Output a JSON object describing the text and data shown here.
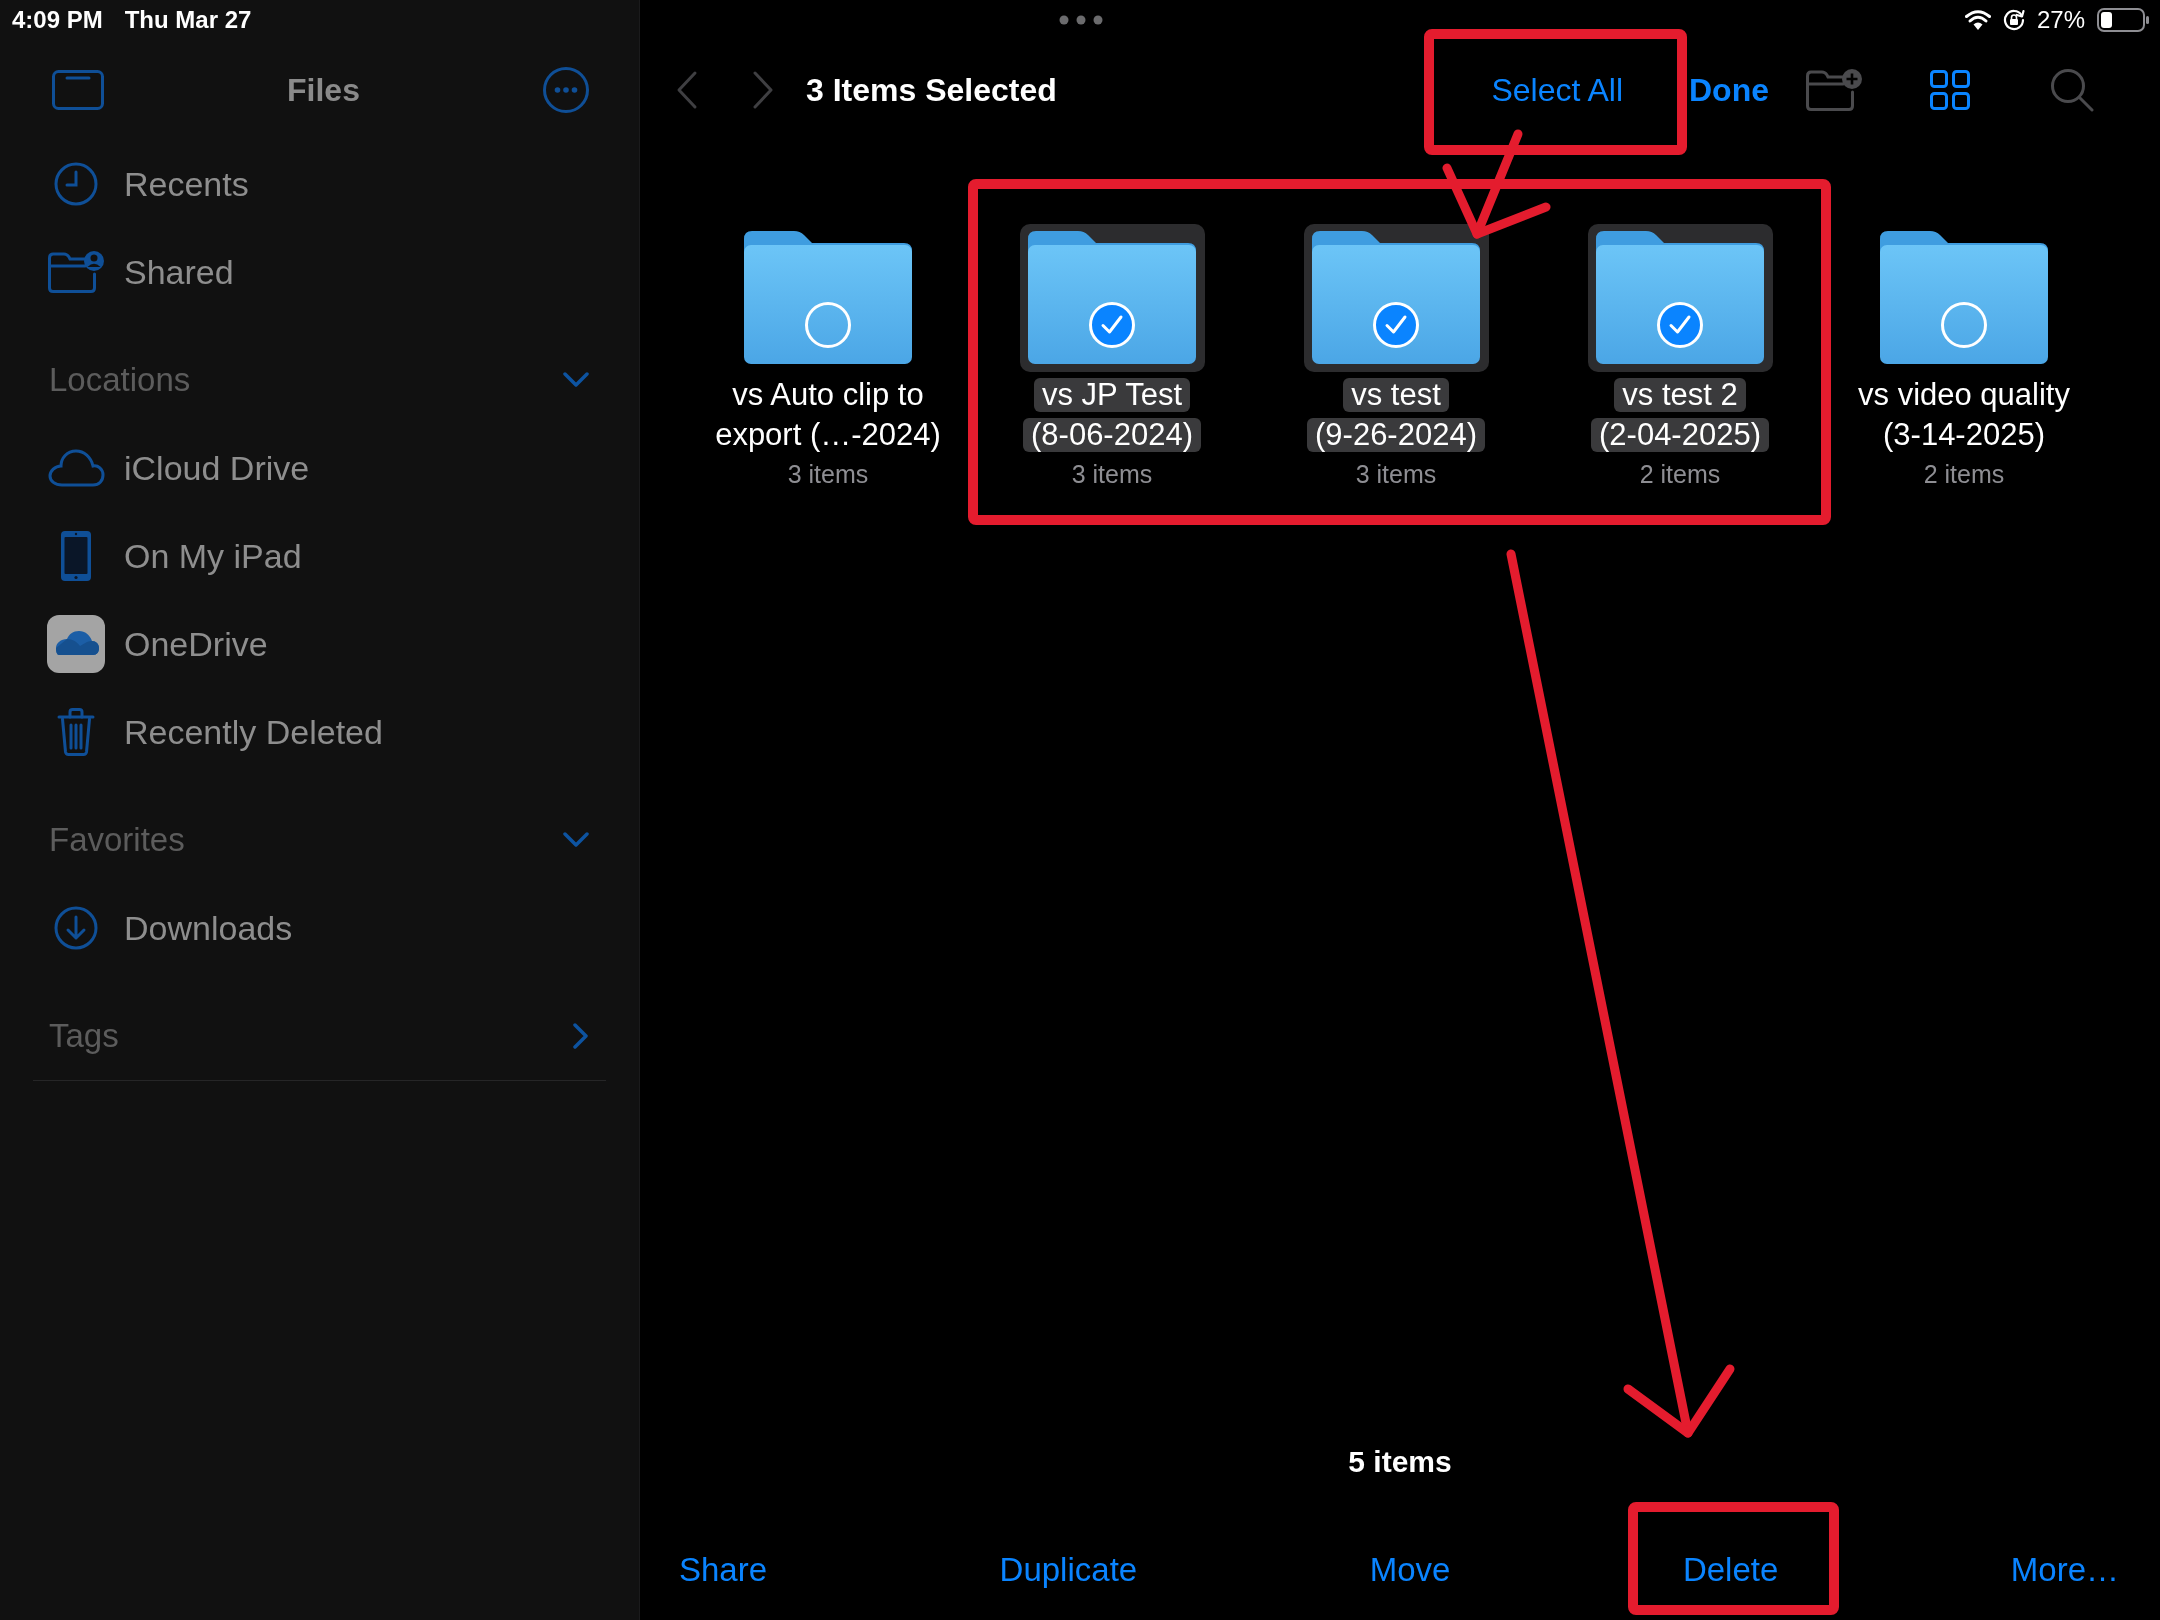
{
  "status_bar": {
    "time": "4:09 PM",
    "date": "Thu Mar 27",
    "battery": "27%"
  },
  "sidebar": {
    "title": "Files",
    "items": [
      "Recents",
      "Shared"
    ],
    "sections": [
      {
        "title": "Locations",
        "expanded": true,
        "items": [
          "iCloud Drive",
          "On My iPad",
          "OneDrive",
          "Recently Deleted"
        ]
      },
      {
        "title": "Favorites",
        "expanded": true,
        "items": [
          "Downloads"
        ]
      },
      {
        "title": "Tags",
        "expanded": false
      }
    ]
  },
  "toolbar": {
    "nav": [
      {
        "disabled": true
      },
      {
        "disabled": true
      }
    ],
    "title": "3 Items Selected",
    "select_all": "Select All",
    "done": "Done",
    "tools": [
      {
        "disabled": true
      },
      {
        "disabled": false
      },
      {
        "disabled": true
      }
    ]
  },
  "folders": [
    {
      "name": "vs Auto clip to\nexport (…-2024)",
      "count": "3 items",
      "selected": false
    },
    {
      "name": "vs JP Test\n(8-06-2024)",
      "count": "3 items",
      "selected": true
    },
    {
      "name": "vs test\n(9-26-2024)",
      "count": "3 items",
      "selected": true
    },
    {
      "name": "vs test 2\n(2-04-2025)",
      "count": "2 items",
      "selected": true
    },
    {
      "name": "vs video quality\n(3-14-2025)",
      "count": "2 items",
      "selected": false
    }
  ],
  "footer": {
    "summary": "5 items",
    "actions": [
      "Share",
      "Duplicate",
      "Move",
      "Delete",
      "More…"
    ]
  },
  "annotations": [
    {
      "kind": "frame"
    },
    {
      "kind": "arrow"
    },
    {
      "kind": "frame"
    },
    {
      "kind": "arrow"
    },
    {
      "kind": "frame"
    }
  ]
}
